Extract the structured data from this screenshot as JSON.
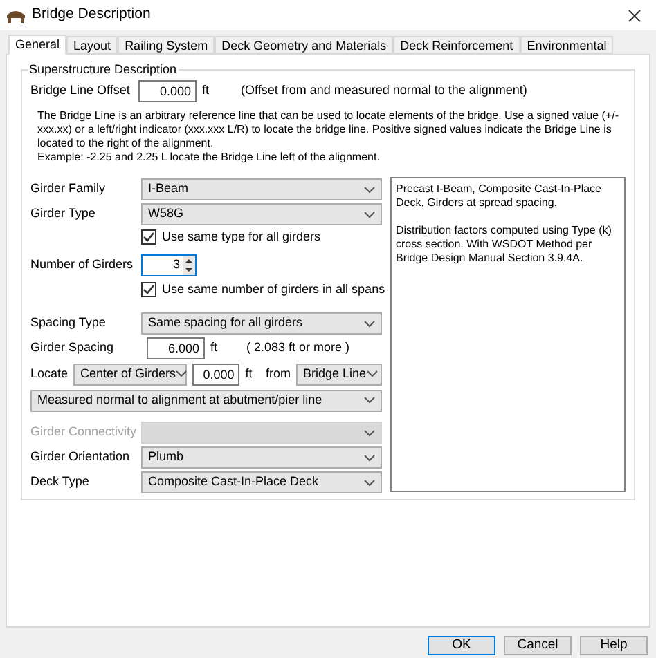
{
  "window": {
    "title": "Bridge Description"
  },
  "tabs": [
    {
      "label": "General",
      "selected": true
    },
    {
      "label": "Layout",
      "selected": false
    },
    {
      "label": "Railing System",
      "selected": false
    },
    {
      "label": "Deck Geometry and Materials",
      "selected": false
    },
    {
      "label": "Deck Reinforcement",
      "selected": false
    },
    {
      "label": "Environmental",
      "selected": false
    }
  ],
  "group": {
    "title": "Superstructure Description"
  },
  "bridge_line_offset": {
    "label": "Bridge Line Offset",
    "value": "0.000",
    "unit": "ft",
    "note": "(Offset from and measured normal to the alignment)"
  },
  "explanation": [
    "The Bridge Line is an arbitrary reference line that can be used to locate elements of the bridge. Use a signed value (+/-xxx.xx) or a left/right indicator (xxx.xxx L/R) to locate the bridge line. Positive signed values indicate the Bridge Line is located to the right of the alignment.",
    "Example: -2.25 and 2.25 L locate the Bridge Line left of the alignment."
  ],
  "girder_family": {
    "label": "Girder Family",
    "value": "I-Beam"
  },
  "girder_type": {
    "label": "Girder Type",
    "value": "W58G",
    "checkbox": {
      "label": "Use same type for all girders",
      "checked": true
    }
  },
  "number_of_girders": {
    "label": "Number of Girders",
    "value": "3",
    "checkbox": {
      "label": "Use same number of girders in all spans",
      "checked": true
    }
  },
  "spacing_type": {
    "label": "Spacing Type",
    "value": "Same spacing for all girders"
  },
  "girder_spacing": {
    "label": "Girder Spacing",
    "value": "6.000",
    "unit": "ft",
    "note": "( 2.083 ft or more )"
  },
  "locate": {
    "label": "Locate",
    "what": "Center of Girders",
    "value": "0.000",
    "unit": "ft",
    "from_label": "from",
    "from": "Bridge Line"
  },
  "measurement": {
    "value": "Measured normal to alignment at abutment/pier line"
  },
  "girder_connectivity": {
    "label": "Girder Connectivity",
    "disabled": true
  },
  "girder_orientation": {
    "label": "Girder Orientation",
    "value": "Plumb"
  },
  "deck_type": {
    "label": "Deck Type",
    "value": "Composite Cast-In-Place Deck"
  },
  "description": [
    "Precast I-Beam, Composite Cast-In-Place Deck, Girders at spread spacing.",
    "Distribution factors computed using Type (k) cross section. With WSDOT Method per Bridge Design Manual Section 3.9.4A."
  ],
  "buttons": [
    {
      "label": "OK",
      "default": true
    },
    {
      "label": "Cancel",
      "default": false
    },
    {
      "label": "Help",
      "default": false
    }
  ]
}
